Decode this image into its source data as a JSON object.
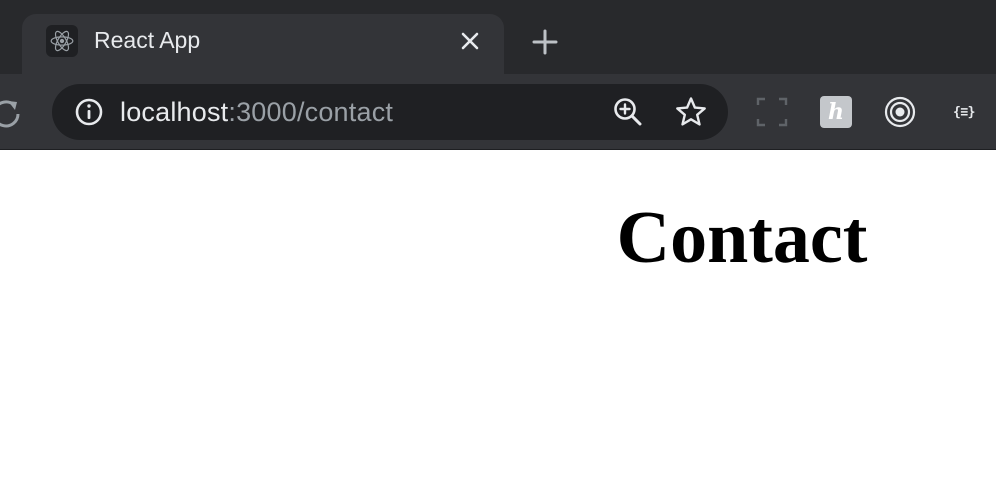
{
  "browser": {
    "tab": {
      "title": "React App",
      "favicon": "react-logo-icon"
    },
    "omnibox": {
      "url_host": "localhost",
      "url_rest": ":3000/contact"
    },
    "icons": {
      "reload": "reload-icon",
      "info": "info-icon",
      "zoom": "zoom-in-icon",
      "bookmark": "star-icon",
      "close_tab": "close-icon",
      "new_tab": "plus-icon"
    },
    "extensions": [
      {
        "name": "screenshot-extension-icon"
      },
      {
        "name": "h-extension-icon",
        "label": "h"
      },
      {
        "name": "target-extension-icon"
      },
      {
        "name": "json-viewer-extension-icon",
        "label": "{≡}"
      }
    ],
    "colors": {
      "chrome": "#333438",
      "tab_strip": "#28292c",
      "omnibox": "#1f2023",
      "text": "#e8eaed",
      "muted_text": "#9aa0a6"
    }
  },
  "page": {
    "heading": "Contact"
  }
}
